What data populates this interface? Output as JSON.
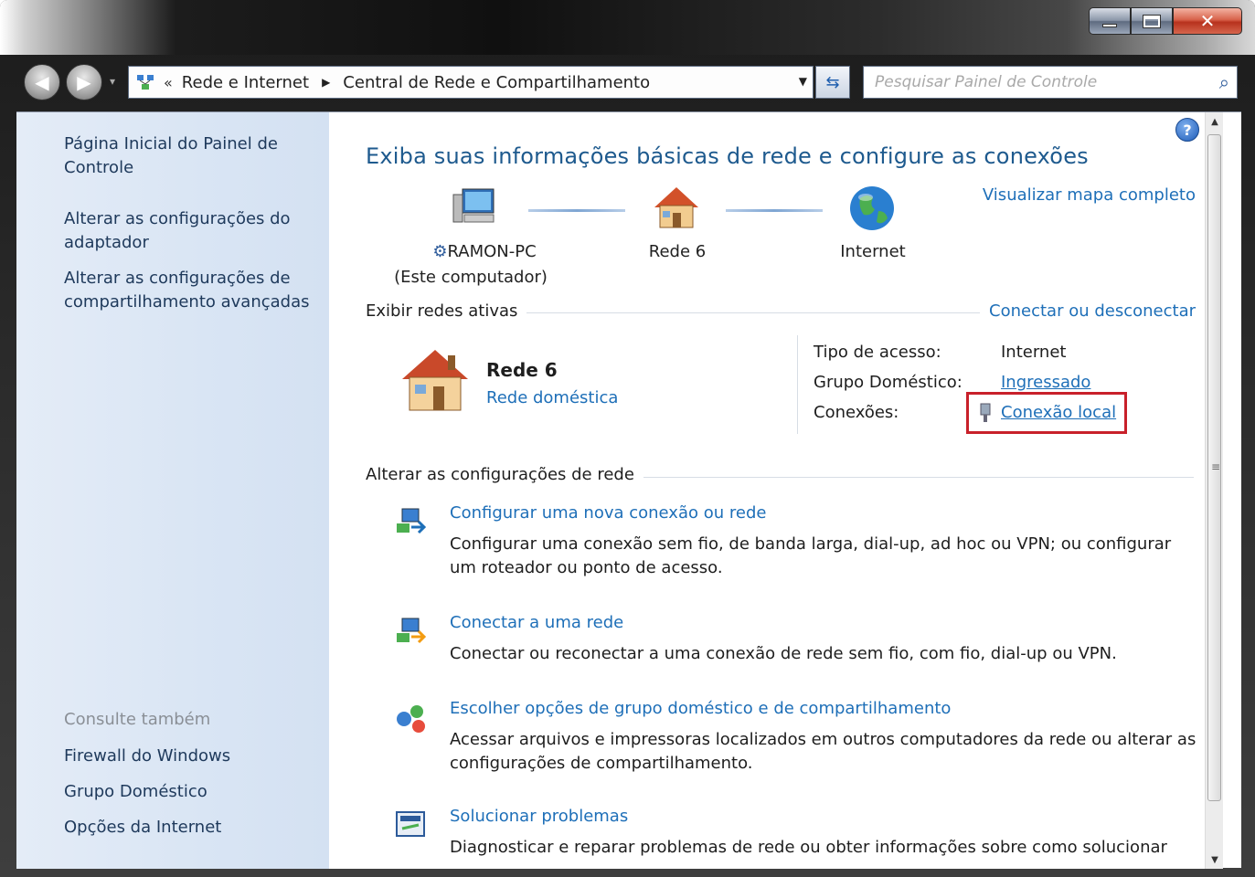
{
  "address": {
    "prefix": "«",
    "segments": [
      "Rede e Internet",
      "Central de Rede e Compartilhamento"
    ]
  },
  "search": {
    "placeholder": "Pesquisar Painel de Controle"
  },
  "sidebar": {
    "links": [
      "Página Inicial do Painel de Controle",
      "Alterar as configurações do adaptador",
      "Alterar as configurações de compartilhamento avançadas"
    ],
    "see_also_title": "Consulte também",
    "see_also": [
      "Firewall do Windows",
      "Grupo Doméstico",
      "Opções da Internet"
    ]
  },
  "main": {
    "heading": "Exiba suas informações básicas de rede e configure as conexões",
    "view_map": "Visualizar mapa completo",
    "map": {
      "computer_name": "RAMON-PC",
      "computer_sub": "(Este computador)",
      "network": "Rede 6",
      "internet": "Internet"
    },
    "active_networks_title": "Exibir redes ativas",
    "connect_link": "Conectar ou desconectar",
    "network": {
      "name": "Rede  6",
      "type": "Rede doméstica",
      "access_type_label": "Tipo de acesso:",
      "access_type_value": "Internet",
      "homegroup_label": "Grupo Doméstico:",
      "homegroup_value": "Ingressado",
      "connections_label": "Conexões:",
      "connections_value": "Conexão local"
    },
    "change_settings_title": "Alterar as configurações de rede",
    "tasks": [
      {
        "title": "Configurar uma nova conexão ou rede",
        "desc": "Configurar uma conexão sem fio, de banda larga, dial-up, ad hoc ou VPN; ou configurar um roteador ou ponto de acesso."
      },
      {
        "title": "Conectar a uma rede",
        "desc": "Conectar ou reconectar a uma conexão de rede sem fio, com fio, dial-up ou VPN."
      },
      {
        "title": "Escolher opções de grupo doméstico e de compartilhamento",
        "desc": "Acessar arquivos e impressoras localizados em outros computadores da rede ou alterar as configurações de compartilhamento."
      },
      {
        "title": "Solucionar problemas",
        "desc": "Diagnosticar e reparar problemas de rede ou obter informações sobre como solucionar"
      }
    ]
  },
  "colors": {
    "link": "#1e6fb8",
    "highlight": "#c8202a",
    "sidebar": "#d9e5f4"
  }
}
